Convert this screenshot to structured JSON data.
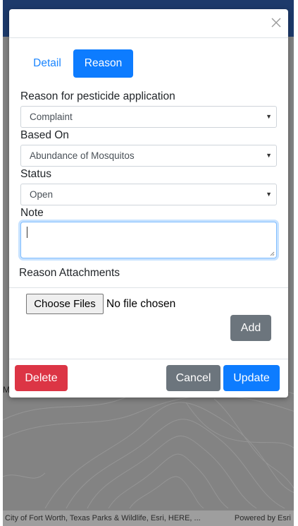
{
  "map": {
    "attribution": "City of Fort Worth, Texas Parks & Wildlife, Esri, HERE, ...",
    "powered_by": "Powered by Esri",
    "edge_letter": "M"
  },
  "modal": {
    "close_icon": "close-icon",
    "tabs": [
      {
        "label": "Detail",
        "active": false
      },
      {
        "label": "Reason",
        "active": true
      }
    ],
    "fields": {
      "reason_label": "Reason for pesticide application",
      "reason_value": "Complaint",
      "based_on_label": "Based On",
      "based_on_value": "Abundance of Mosquitos",
      "status_label": "Status",
      "status_value": "Open",
      "note_label": "Note",
      "note_value": ""
    },
    "attachments": {
      "label": "Reason Attachments",
      "choose_files": "Choose Files",
      "file_status": "No file chosen",
      "add": "Add"
    },
    "footer": {
      "delete": "Delete",
      "cancel": "Cancel",
      "update": "Update"
    }
  },
  "colors": {
    "primary": "#0d7cff",
    "secondary": "#6c757d",
    "danger": "#dc3545",
    "header_bar": "#1d3a6b"
  }
}
